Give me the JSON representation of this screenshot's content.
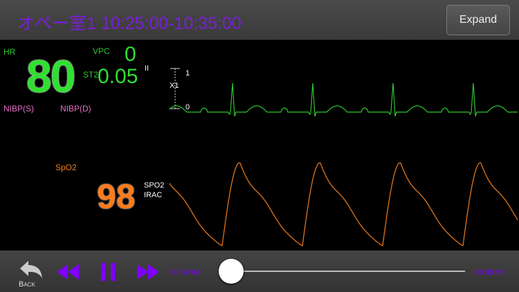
{
  "header": {
    "title": "オペー室1  10:25:00-10:35:00",
    "expand_label": "Expand"
  },
  "ecg": {
    "hr_label": "HR",
    "hr_value": "80",
    "vpc_label": "VPC",
    "vpc_value": "0",
    "st_label": "ST2",
    "st_value": "0.05",
    "lead": "II",
    "scale_top": "1",
    "scale_label": "X1",
    "scale_bottom": "0",
    "color": "#2ec62e"
  },
  "nibp": {
    "s_label": "NIBP(S)",
    "d_label": "NIBP(D)"
  },
  "spo2": {
    "label": "SpO2",
    "value": "98",
    "source_line1": "SPO2",
    "source_line2": "IRAC",
    "color": "#f07d1e"
  },
  "player": {
    "back_label": "Back",
    "elapsed": "00:00:04",
    "remaining": "00:09:56",
    "progress": 0.007,
    "accent": "#7f00ff"
  }
}
